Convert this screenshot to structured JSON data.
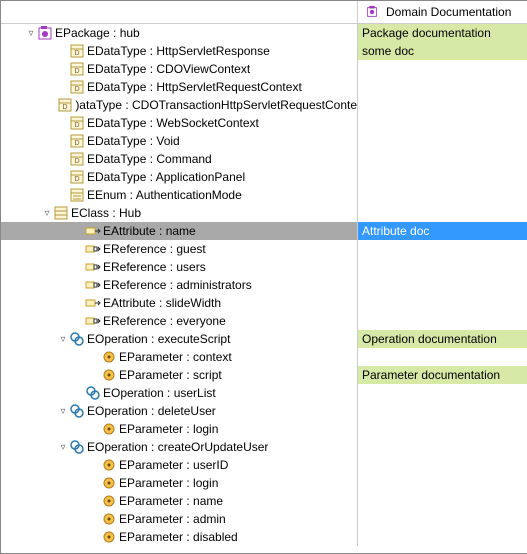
{
  "header": {
    "docColumn": "Domain Documentation"
  },
  "rows": [
    {
      "indent": 1,
      "toggle": "▿",
      "icon": "package",
      "label": "EPackage : hub",
      "doc": "Package documentation",
      "greenish": true,
      "interact": true
    },
    {
      "indent": 3,
      "toggle": "",
      "icon": "datatype",
      "label": "EDataType : HttpServletResponse",
      "doc": "some doc",
      "greenish": true,
      "interact": true
    },
    {
      "indent": 3,
      "toggle": "",
      "icon": "datatype",
      "label": "EDataType : CDOViewContext",
      "doc": "",
      "interact": true
    },
    {
      "indent": 3,
      "toggle": "",
      "icon": "datatype",
      "label": "EDataType : HttpServletRequestContext",
      "doc": "",
      "interact": true
    },
    {
      "indent": 3,
      "toggle": "",
      "icon": "datatype",
      "label": ")ataType : CDOTransactionHttpServletRequestConte",
      "doc": "",
      "interact": true
    },
    {
      "indent": 3,
      "toggle": "",
      "icon": "datatype",
      "label": "EDataType : WebSocketContext",
      "doc": "",
      "interact": true
    },
    {
      "indent": 3,
      "toggle": "",
      "icon": "datatype",
      "label": "EDataType : Void",
      "doc": "",
      "interact": true
    },
    {
      "indent": 3,
      "toggle": "",
      "icon": "datatype",
      "label": "EDataType : Command",
      "doc": "",
      "interact": true
    },
    {
      "indent": 3,
      "toggle": "",
      "icon": "datatype",
      "label": "EDataType : ApplicationPanel",
      "doc": "",
      "interact": true
    },
    {
      "indent": 3,
      "toggle": "",
      "icon": "enum",
      "label": "EEnum : AuthenticationMode",
      "doc": "",
      "interact": true
    },
    {
      "indent": 2,
      "toggle": "▿",
      "icon": "class",
      "label": "EClass : Hub",
      "doc": "",
      "interact": true
    },
    {
      "indent": 4,
      "toggle": "",
      "icon": "attribute",
      "label": "EAttribute : name",
      "doc": "Attribute doc",
      "selected": true,
      "interact": true
    },
    {
      "indent": 4,
      "toggle": "",
      "icon": "reference",
      "label": "EReference : guest",
      "doc": "",
      "white": true,
      "interact": true
    },
    {
      "indent": 4,
      "toggle": "",
      "icon": "reference",
      "label": "EReference : users",
      "doc": "",
      "white": true,
      "interact": true
    },
    {
      "indent": 4,
      "toggle": "",
      "icon": "reference",
      "label": "EReference : administrators",
      "doc": "",
      "interact": true
    },
    {
      "indent": 4,
      "toggle": "",
      "icon": "attribute",
      "label": "EAttribute : slideWidth",
      "doc": "",
      "interact": true
    },
    {
      "indent": 4,
      "toggle": "",
      "icon": "reference",
      "label": "EReference : everyone",
      "doc": "",
      "interact": true
    },
    {
      "indent": 3,
      "toggle": "▿",
      "icon": "operation",
      "label": "EOperation : executeScript",
      "doc": "Operation documentation",
      "greenish": true,
      "interact": true
    },
    {
      "indent": 5,
      "toggle": "",
      "icon": "parameter",
      "label": "EParameter : context",
      "doc": "",
      "interact": true
    },
    {
      "indent": 5,
      "toggle": "",
      "icon": "parameter",
      "label": "EParameter : script",
      "doc": "Parameter documentation",
      "greenish": true,
      "interact": true
    },
    {
      "indent": 4,
      "toggle": "",
      "icon": "operation",
      "label": "EOperation : userList",
      "doc": "",
      "interact": true
    },
    {
      "indent": 3,
      "toggle": "▿",
      "icon": "operation",
      "label": "EOperation : deleteUser",
      "doc": "",
      "interact": true
    },
    {
      "indent": 5,
      "toggle": "",
      "icon": "parameter",
      "label": "EParameter : login",
      "doc": "",
      "interact": true
    },
    {
      "indent": 3,
      "toggle": "▿",
      "icon": "operation",
      "label": "EOperation : createOrUpdateUser",
      "doc": "",
      "interact": true
    },
    {
      "indent": 5,
      "toggle": "",
      "icon": "parameter",
      "label": "EParameter : userID",
      "doc": "",
      "interact": true
    },
    {
      "indent": 5,
      "toggle": "",
      "icon": "parameter",
      "label": "EParameter : login",
      "doc": "",
      "interact": true
    },
    {
      "indent": 5,
      "toggle": "",
      "icon": "parameter",
      "label": "EParameter : name",
      "doc": "",
      "interact": true
    },
    {
      "indent": 5,
      "toggle": "",
      "icon": "parameter",
      "label": "EParameter : admin",
      "doc": "",
      "interact": true
    },
    {
      "indent": 5,
      "toggle": "",
      "icon": "parameter",
      "label": "EParameter : disabled",
      "doc": "",
      "interact": true
    }
  ]
}
